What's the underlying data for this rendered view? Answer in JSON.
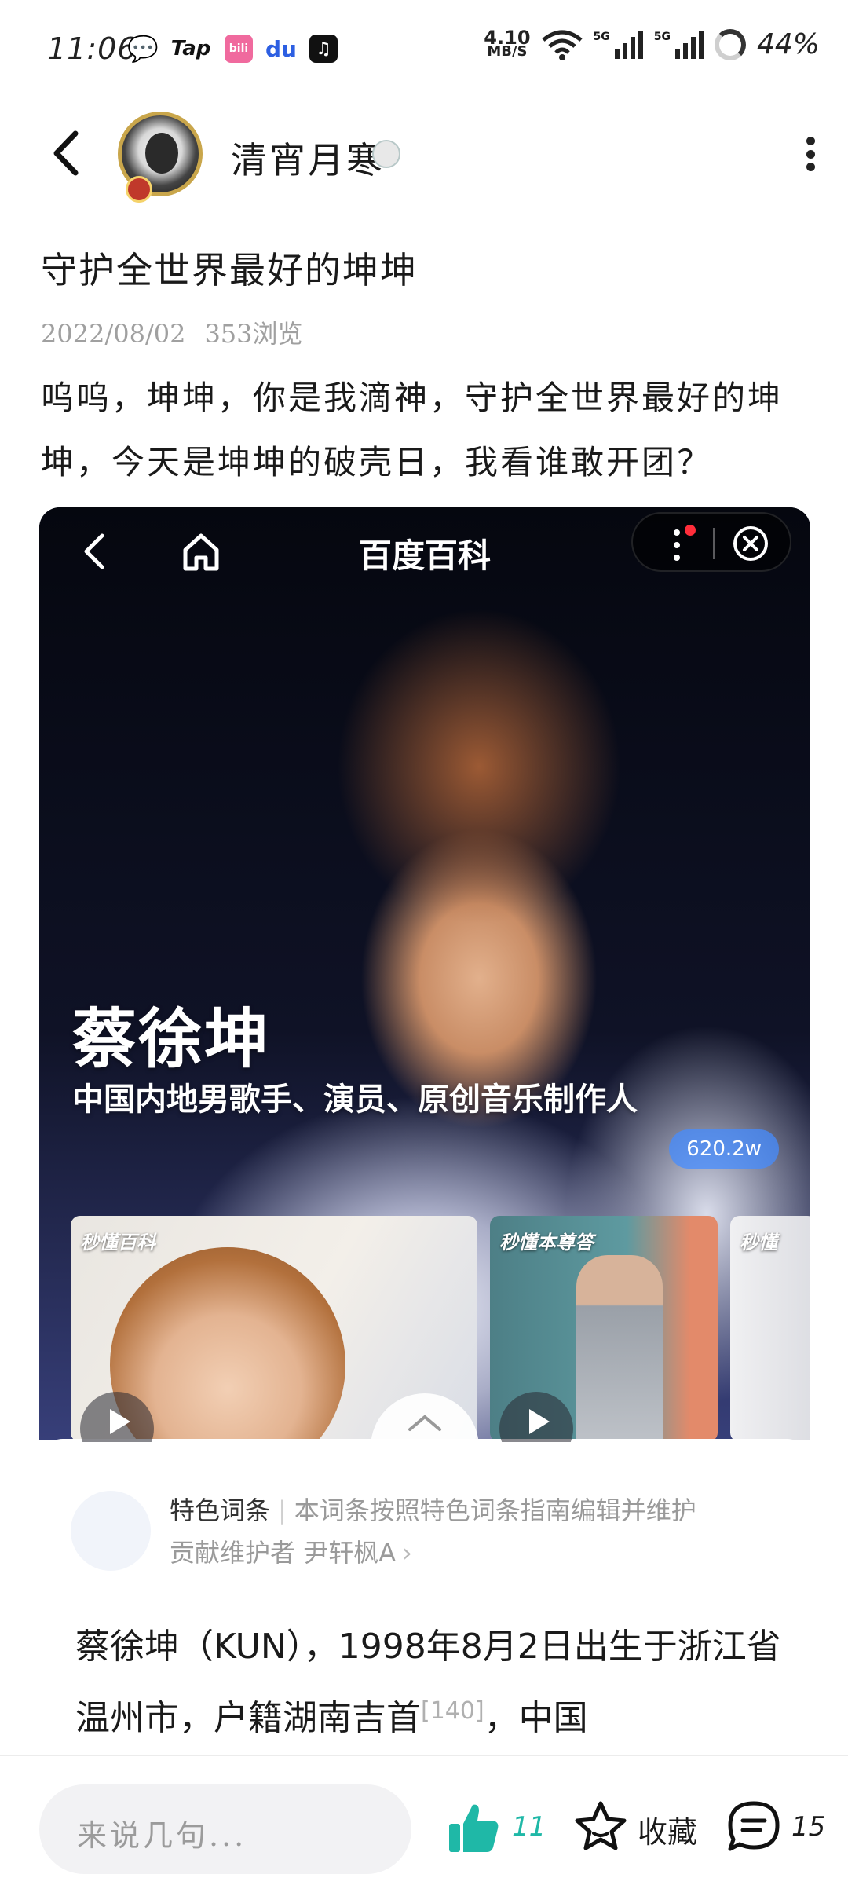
{
  "status_bar": {
    "time": "11:06",
    "app_icons": [
      "wechat-icon",
      "taptap-icon",
      "bilibili-icon",
      "baidu-icon",
      "tiktok-icon"
    ],
    "tap_label": "Tap",
    "bili_label": "bili",
    "du_label": "du",
    "net_speed_value": "4.10",
    "net_speed_unit": "MB/S",
    "signal_label_1": "5G",
    "signal_label_2": "5G",
    "battery_percent": "44%"
  },
  "header": {
    "username": "清宵月寒",
    "back_icon": "back-arrow-icon",
    "more_icon": "vertical-dots-icon"
  },
  "post": {
    "title": "守护全世界最好的坤坤",
    "date": "2022/08/02",
    "views": "353浏览",
    "body": "呜呜，坤坤，你是我滴神，守护全世界最好的坤坤，今天是坤坤的破壳日，我看谁敢开团？"
  },
  "embedded": {
    "app_title": "百度百科",
    "person_name": "蔡徐坤",
    "person_description": "中国内地男歌手、演员、原创音乐制作人",
    "view_count": "620.2w",
    "cards": [
      {
        "logo": "秒懂百科"
      },
      {
        "logo": "秒懂本尊答"
      },
      {
        "logo": "秒懂"
      }
    ],
    "feature_label": "特色词条",
    "feature_desc": "本词条按照特色词条指南编辑并维护",
    "maintainer_prefix": "贡献维护者",
    "maintainer_name": "尹轩枫A",
    "bio_part1": "蔡徐坤（KUN），1998年8月2日出生于浙江省温州市，户籍湖南吉首",
    "bio_ref": "[140]",
    "bio_part2": "，中国"
  },
  "bottom_bar": {
    "comment_placeholder": "来说几句...",
    "like_count": "11",
    "favorite_label": "收藏",
    "comment_count": "15"
  },
  "colors": {
    "accent_teal": "#1fb8a7",
    "baidu_blue_badge": "#468cff",
    "notification_red": "#ff2d3a"
  }
}
